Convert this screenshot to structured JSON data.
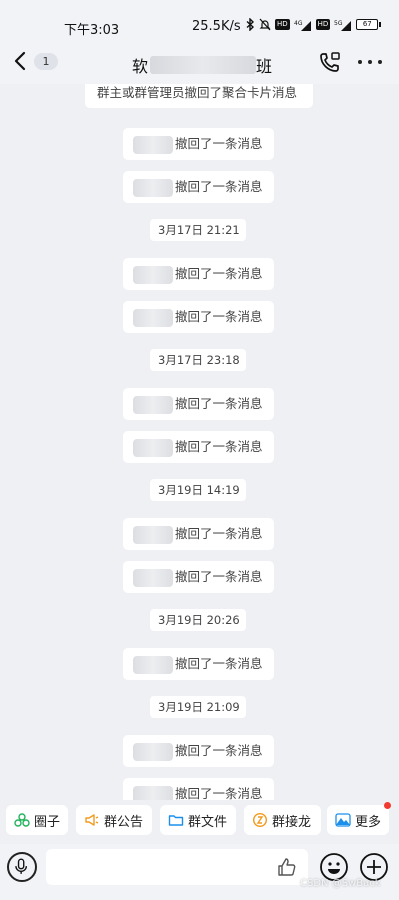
{
  "status_bar": {
    "time": "下午3:03",
    "net_rate": "25.5K/s",
    "icons": [
      "bluetooth-icon",
      "mute-icon",
      "hd-icon",
      "4g-signal-icon",
      "hd-icon",
      "5g-signal-icon"
    ],
    "hd_label": "HD",
    "battery": "67"
  },
  "header": {
    "unread_count": "1",
    "title_first": "软",
    "title_last": "班"
  },
  "messages": [
    {
      "type": "system",
      "text": "群主或群管理员撤回了聚合卡片消息"
    },
    {
      "type": "recall",
      "text": "撤回了一条消息"
    },
    {
      "type": "recall",
      "text": "撤回了一条消息"
    },
    {
      "type": "time",
      "text": "3月17日 21:21"
    },
    {
      "type": "recall",
      "text": "撤回了一条消息"
    },
    {
      "type": "recall",
      "text": "撤回了一条消息"
    },
    {
      "type": "time",
      "text": "3月17日 23:18"
    },
    {
      "type": "recall",
      "text": "撤回了一条消息"
    },
    {
      "type": "recall",
      "text": "撤回了一条消息"
    },
    {
      "type": "time",
      "text": "3月19日 14:19"
    },
    {
      "type": "recall",
      "text": "撤回了一条消息"
    },
    {
      "type": "recall",
      "text": "撤回了一条消息"
    },
    {
      "type": "time",
      "text": "3月19日 20:26"
    },
    {
      "type": "recall",
      "text": "撤回了一条消息"
    },
    {
      "type": "time",
      "text": "3月19日 21:09"
    },
    {
      "type": "recall",
      "text": "撤回了一条消息"
    },
    {
      "type": "recall",
      "text": "撤回了一条消息"
    }
  ],
  "quick_actions": [
    {
      "label": "圈子",
      "icon": "circle-group-icon",
      "color": "#1fb35a"
    },
    {
      "label": "群公告",
      "icon": "announcement-icon",
      "color": "#f29a1d"
    },
    {
      "label": "群文件",
      "icon": "folder-icon",
      "color": "#1c8fea"
    },
    {
      "label": "群接龙",
      "icon": "relay-icon",
      "color": "#f29a1d"
    },
    {
      "label": "更多",
      "icon": "more-apps-icon",
      "color": "#1c8fea"
    }
  ],
  "input": {
    "placeholder": ""
  },
  "watermark": "CSDN @SwBack"
}
